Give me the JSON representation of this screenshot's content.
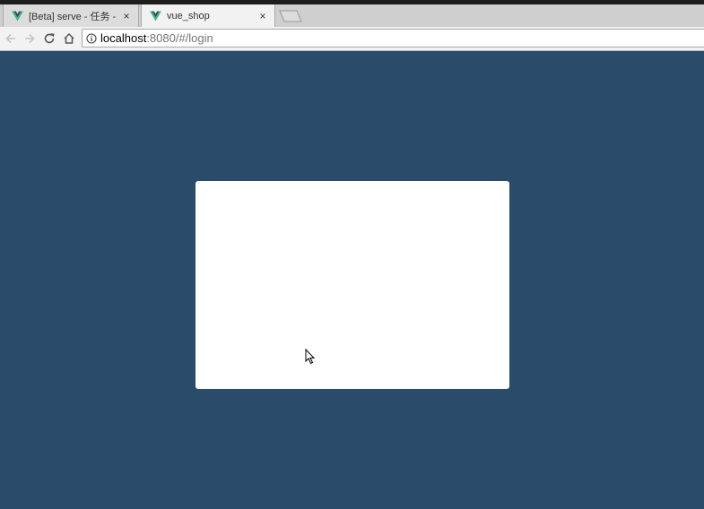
{
  "browser": {
    "tabs": [
      {
        "title": "[Beta] serve - 任务 - Vu",
        "favicon": "vue-logo-icon",
        "close": "×",
        "active": false
      },
      {
        "title": "vue_shop",
        "favicon": "vue-logo-icon",
        "close": "×",
        "active": true
      }
    ],
    "address_bar": {
      "host": "localhost",
      "rest": ":8080/#/login"
    },
    "icons": {
      "back": "back-arrow-icon",
      "forward": "forward-arrow-icon",
      "reload": "reload-icon",
      "home": "home-icon",
      "info": "info-icon"
    }
  },
  "page": {
    "background_color": "#2b4b6b",
    "login_box_color": "#ffffff"
  }
}
